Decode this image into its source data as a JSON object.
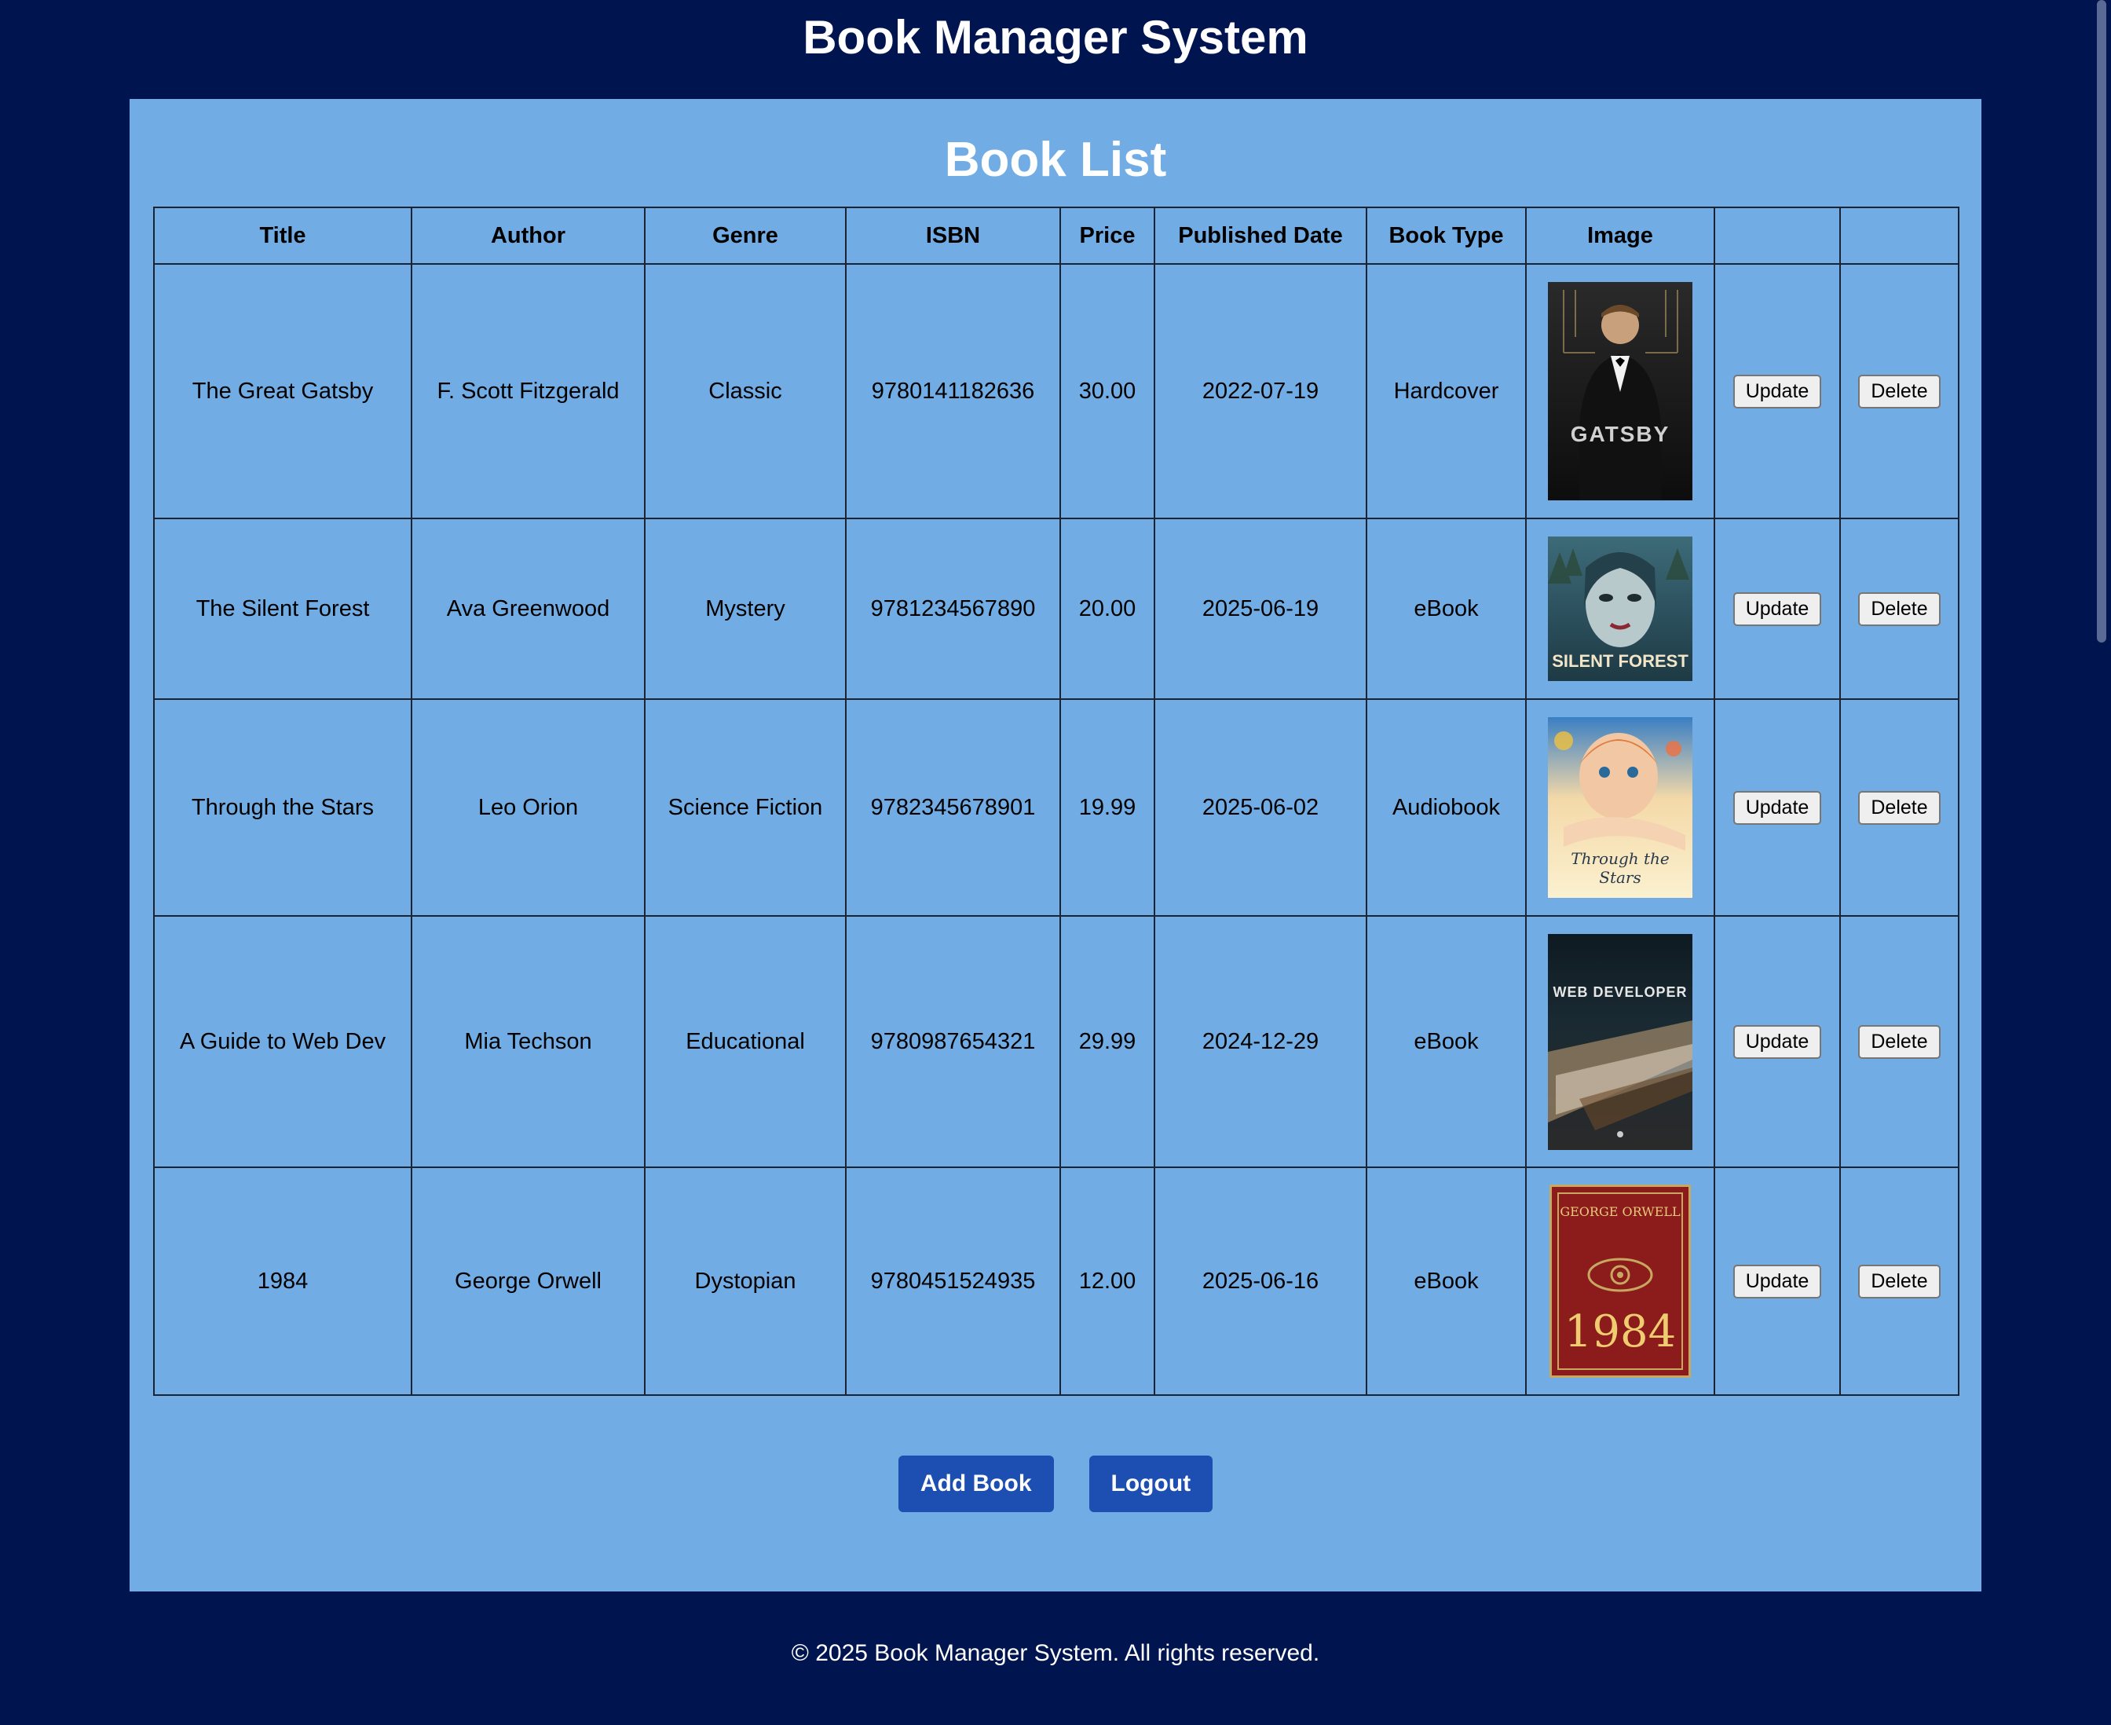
{
  "app": {
    "title": "Book Manager System"
  },
  "page": {
    "heading": "Book List"
  },
  "table": {
    "headers": [
      "Title",
      "Author",
      "Genre",
      "ISBN",
      "Price",
      "Published Date",
      "Book Type",
      "Image",
      "",
      ""
    ],
    "update_label": "Update",
    "delete_label": "Delete",
    "rows": [
      {
        "title": "The Great Gatsby",
        "author": "F. Scott Fitzgerald",
        "genre": "Classic",
        "isbn": "9780141182636",
        "price": "30.00",
        "published": "2022-07-19",
        "type": "Hardcover",
        "cover_text": "GATSBY"
      },
      {
        "title": "The Silent Forest",
        "author": "Ava Greenwood",
        "genre": "Mystery",
        "isbn": "9781234567890",
        "price": "20.00",
        "published": "2025-06-19",
        "type": "eBook",
        "cover_text": "SILENT FOREST"
      },
      {
        "title": "Through the Stars",
        "author": "Leo Orion",
        "genre": "Science Fiction",
        "isbn": "9782345678901",
        "price": "19.99",
        "published": "2025-06-02",
        "type": "Audiobook",
        "cover_text": "Through the Stars"
      },
      {
        "title": "A Guide to Web Dev",
        "author": "Mia Techson",
        "genre": "Educational",
        "isbn": "9780987654321",
        "price": "29.99",
        "published": "2024-12-29",
        "type": "eBook",
        "cover_text": "WEB DEVELOPER"
      },
      {
        "title": "1984",
        "author": "George Orwell",
        "genre": "Dystopian",
        "isbn": "9780451524935",
        "price": "12.00",
        "published": "2025-06-16",
        "type": "eBook",
        "cover_text": "1984",
        "cover_author": "GEORGE ORWELL"
      }
    ]
  },
  "actions": {
    "add_label": "Add Book",
    "logout_label": "Logout"
  },
  "footer": {
    "text": "© 2025 Book Manager System. All rights reserved."
  },
  "colors": {
    "background": "#001550",
    "panel": "#71ade4",
    "button": "#1d4fb2"
  }
}
